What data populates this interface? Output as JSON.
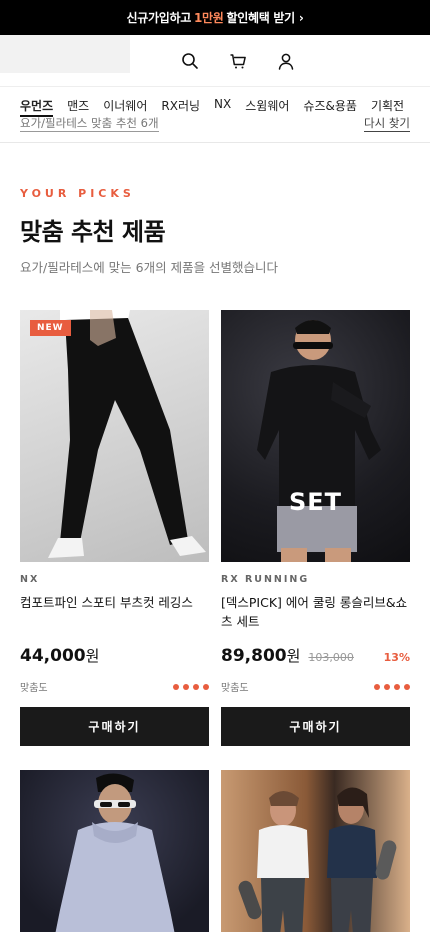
{
  "promo": {
    "text_a": "신규가입하고",
    "highlight": "1만원",
    "text_b": "할인혜택 받기",
    "chevron": "›"
  },
  "header": {
    "icons": [
      "search-icon",
      "cart-icon",
      "user-icon"
    ]
  },
  "categories": {
    "items": [
      "우먼즈",
      "맨즈",
      "이너웨어",
      "RX러닝",
      "NX",
      "스윔웨어",
      "슈즈&용품",
      "기획전"
    ],
    "active": "우먼즈",
    "context": "요가/필라테스 맞춤 추천 6개",
    "reset": "다시 찾기"
  },
  "hero": {
    "eyebrow": "YOUR PICKS",
    "title": "맞춤 추천 제품",
    "description": "요가/필라테스에 맞는 6개의 제품을 선별했습니다"
  },
  "products": [
    {
      "badge": "NEW",
      "brand": "NX",
      "name": "컴포트파인 스포티 부츠컷 레깅스",
      "price": "44,000",
      "unit": "원",
      "original": "",
      "discount": "",
      "fit_label": "맞춤도",
      "fit_score": 4,
      "buy": "구매하기"
    },
    {
      "overlay": "SET",
      "brand": "RX RUNNING",
      "name": "[덱스PICK] 에어 쿨링 롱슬리브&쇼츠 세트",
      "price": "89,800",
      "unit": "원",
      "original": "103,000",
      "discount": "13%",
      "fit_label": "맞춤도",
      "fit_score": 4,
      "buy": "구매하기"
    }
  ],
  "colors": {
    "accent": "#e85d3f",
    "button": "#1a1a1a",
    "promo_bg": "#000000"
  }
}
